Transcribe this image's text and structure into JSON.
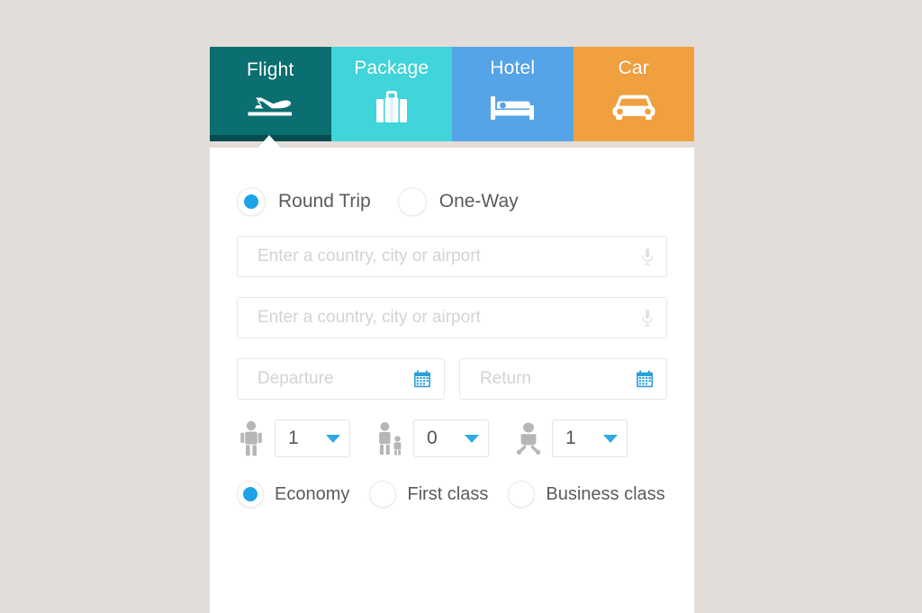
{
  "theme": {
    "page_background": "#e2ddd8",
    "card_background": "#ffffff",
    "accent_blue": "#1ea2e8",
    "caret_blue": "#2eaae4",
    "calendar_blue": "#2e9fd6",
    "text_gray": "#5b5b5b",
    "placeholder_gray": "#d5d3d1"
  },
  "tabs": [
    {
      "label": "Flight",
      "icon": "airplane-icon",
      "color": "#0b6e71",
      "active": true
    },
    {
      "label": "Package",
      "icon": "suitcase-icon",
      "color": "#3fd5db",
      "active": false
    },
    {
      "label": "Hotel",
      "icon": "bed-icon",
      "color": "#56a4e8",
      "active": false
    },
    {
      "label": "Car",
      "icon": "car-icon",
      "color": "#f0a03f",
      "active": false
    }
  ],
  "trip_type": {
    "options": [
      {
        "label": "Round Trip",
        "selected": true
      },
      {
        "label": "One-Way",
        "selected": false
      }
    ]
  },
  "origin": {
    "placeholder": "Enter a country, city or airport",
    "value": "",
    "icon": "microphone-icon"
  },
  "destination": {
    "placeholder": "Enter a country, city or airport",
    "value": "",
    "icon": "microphone-icon"
  },
  "departure": {
    "placeholder": "Departure",
    "value": "",
    "icon": "calendar-icon"
  },
  "return": {
    "placeholder": "Return",
    "value": "",
    "icon": "calendar-icon"
  },
  "passengers": [
    {
      "type": "adult",
      "icon": "adult-passenger-icon",
      "value": "1"
    },
    {
      "type": "child",
      "icon": "child-passenger-icon",
      "value": "0"
    },
    {
      "type": "infant",
      "icon": "infant-passenger-icon",
      "value": "1"
    }
  ],
  "cabin_class": {
    "options": [
      {
        "label": "Economy",
        "selected": true
      },
      {
        "label": "First class",
        "selected": false
      },
      {
        "label": "Business class",
        "selected": false
      }
    ]
  }
}
